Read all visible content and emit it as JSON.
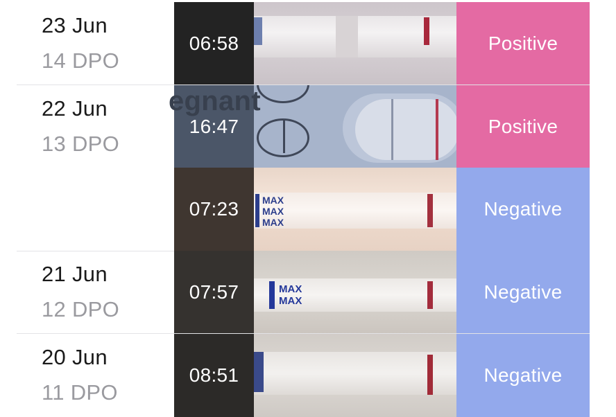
{
  "entries": [
    {
      "date": "23 Jun",
      "dpo": "14 DPO",
      "time": "06:58",
      "result": "Positive",
      "result_color": "#e46aa3"
    },
    {
      "date": "22 Jun",
      "dpo": "13 DPO",
      "time": "16:47",
      "result": "Positive",
      "result_color": "#e46aa3"
    },
    {
      "date": "",
      "dpo": "",
      "time": "07:23",
      "result": "Negative",
      "result_color": "#93a9ec"
    },
    {
      "date": "21 Jun",
      "dpo": "12 DPO",
      "time": "07:57",
      "result": "Negative",
      "result_color": "#93a9ec"
    },
    {
      "date": "20 Jun",
      "dpo": "11 DPO",
      "time": "08:51",
      "result": "Negative",
      "result_color": "#93a9ec"
    }
  ],
  "strip_labels": {
    "max": "MAX",
    "brand_fragment": "egnant"
  },
  "colors": {
    "positive": "#e46aa3",
    "negative": "#93a9ec",
    "date_text": "#1a1a1a",
    "dpo_text": "#9a9a9f",
    "separator": "#e3e3e6"
  }
}
